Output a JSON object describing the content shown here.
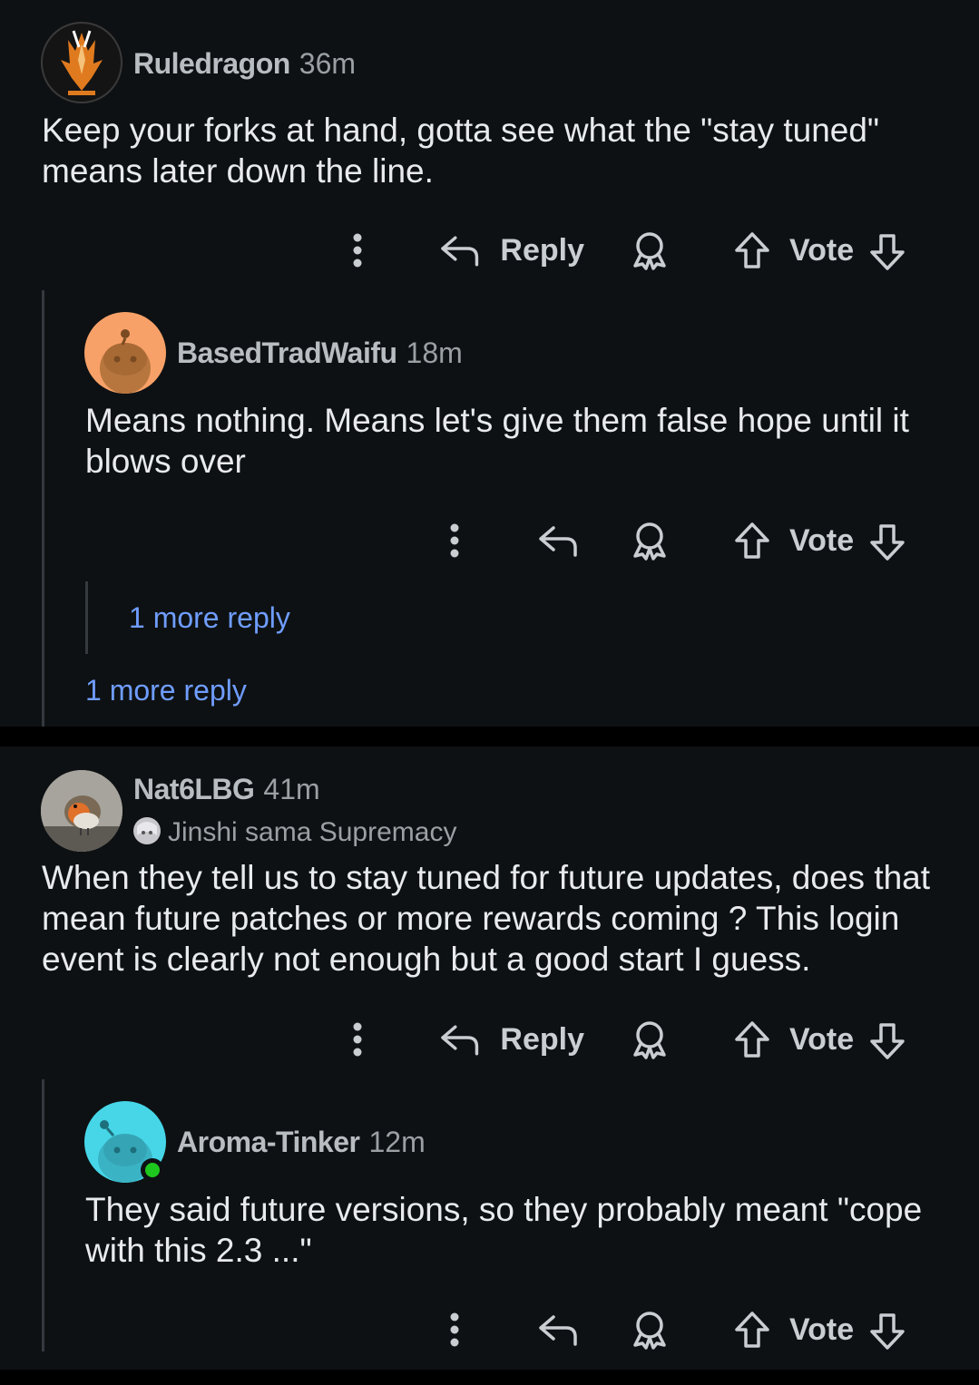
{
  "comments": [
    {
      "author": "Ruledragon",
      "time": "36m",
      "body": "Keep your forks at hand, gotta see what the \"stay tuned\" means later down the line.",
      "reply_label": "Reply",
      "vote_label": "Vote"
    },
    {
      "author": "BasedTradWaifu",
      "time": "18m",
      "body": "Means nothing. Means let's give them false hope until it blows over",
      "vote_label": "Vote",
      "more_replies": "1 more reply"
    },
    {
      "author": "Nat6LBG",
      "time": "41m",
      "flair": "Jinshi sama Supremacy",
      "body": "When they tell us to stay tuned for future updates, does that mean future patches or more rewards coming ? This login event is clearly not enough but a good start I guess.",
      "reply_label": "Reply",
      "vote_label": "Vote"
    },
    {
      "author": "Aroma-Tinker",
      "time": "12m",
      "body": "They said future versions, so they probably meant \"cope with this 2.3 ...\"",
      "vote_label": "Vote"
    }
  ],
  "thread_more_replies": "1 more reply",
  "icons": {
    "more": "more-vertical-icon",
    "reply": "reply-arrow-icon",
    "award": "award-icon",
    "upvote": "upvote-arrow-icon",
    "downvote": "downvote-arrow-icon"
  },
  "colors": {
    "background": "#0e1113",
    "link": "#6f9dff",
    "online": "#1ec71e"
  }
}
